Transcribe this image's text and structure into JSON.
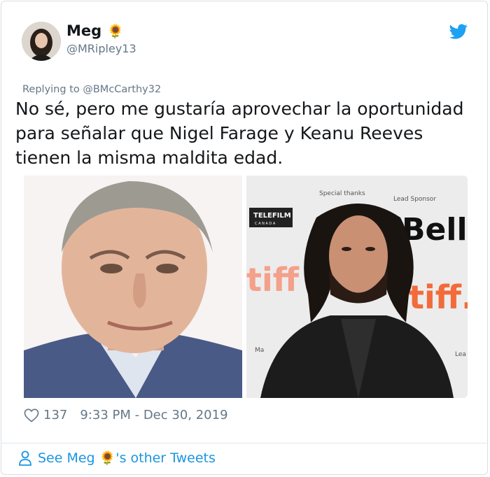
{
  "tweet": {
    "author_name": "Meg",
    "author_emoji": "🌻",
    "handle": "@MRipley13",
    "replying_prefix": "Replying to",
    "replying_to": "@BMcCarthy32",
    "text": "No sé, pero me gustaría aprovechar la oportunidad para señalar que Nigel Farage y Keanu Reeves tienen la misma maldita edad.",
    "likes": "137",
    "timestamp": "9:33 PM - Dec 30, 2019"
  },
  "photos": {
    "right_texts": {
      "special": "Special thanks",
      "lead": "Lead Sponsor",
      "telefilm": "TELEFILM",
      "canada": "C A N A D A",
      "bell": "Bell",
      "tiff_left": "tiff",
      "tiff_right": "tiff.",
      "ma": "Ma",
      "lea": "Lea"
    }
  },
  "footer": {
    "see_prefix": "See Meg",
    "emoji": "🌻",
    "suffix": "'s other Tweets"
  },
  "colors": {
    "accent": "#1da1f2",
    "link": "#1b95e0",
    "muted": "#657786"
  },
  "icons": [
    "twitter-bird-icon",
    "heart-icon",
    "person-icon"
  ]
}
